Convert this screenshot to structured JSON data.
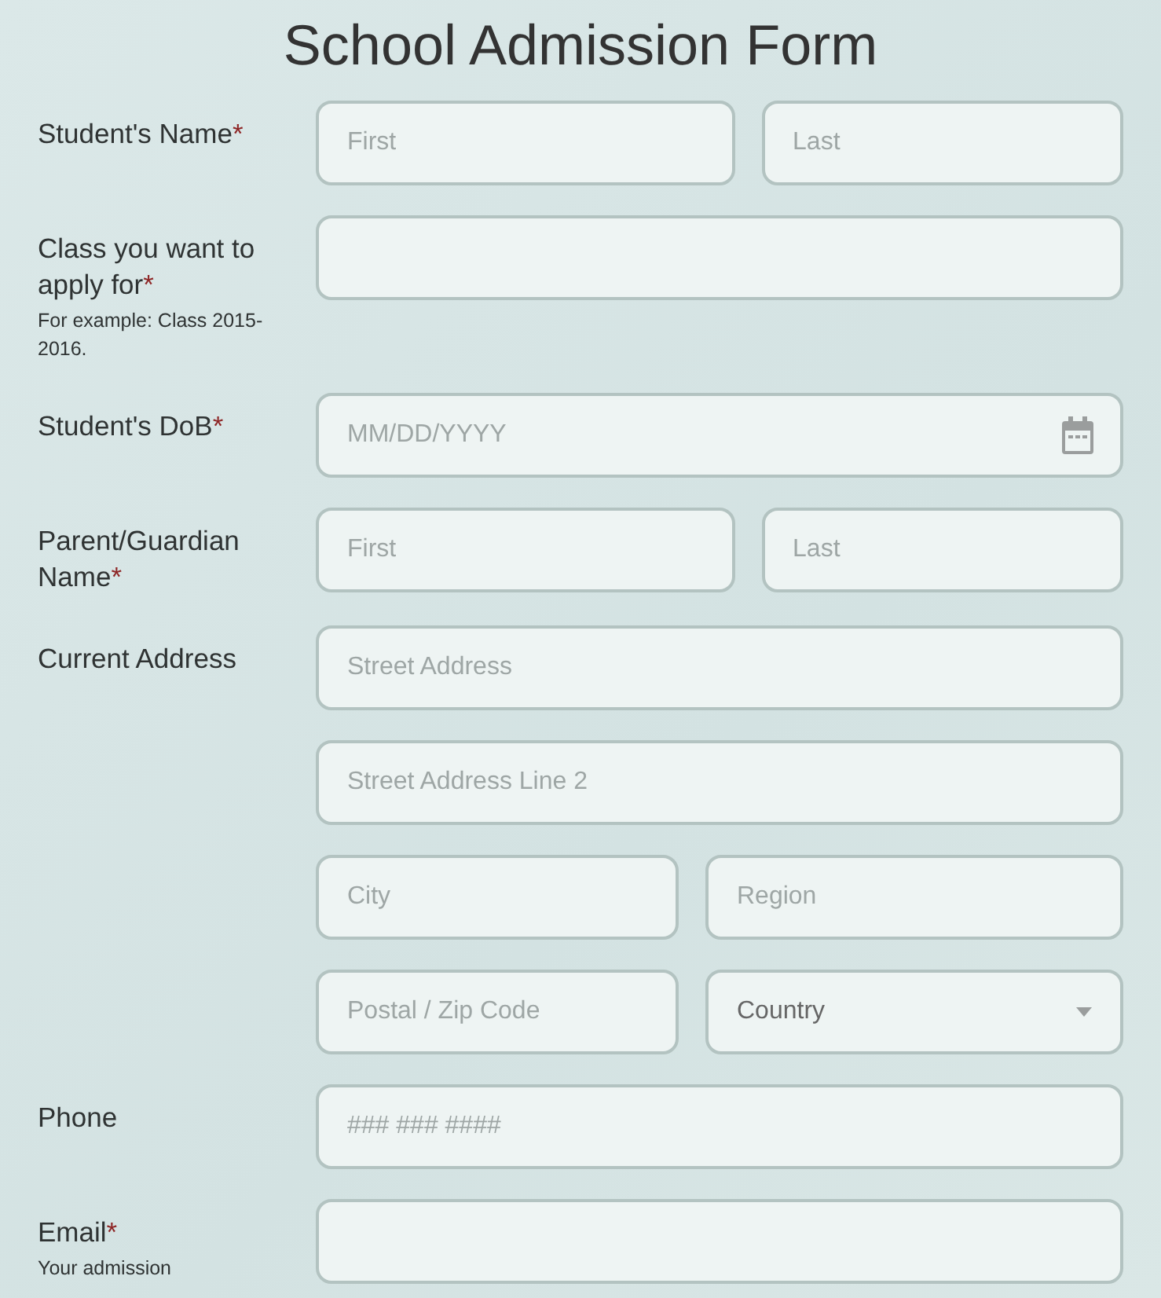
{
  "title": "School Admission Form",
  "rows": [
    {
      "label": "Student's Name",
      "required_mark": "*",
      "lines": [
        [
          {
            "kind": "text",
            "placeholder": "First"
          },
          {
            "kind": "text",
            "placeholder": "Last"
          }
        ]
      ]
    },
    {
      "label": "Class you want to apply for",
      "required_mark": "*",
      "hint": "For example: Class 2015-2016.",
      "lines": [
        [
          {
            "kind": "text"
          }
        ]
      ]
    },
    {
      "label": "Student's DoB",
      "required_mark": "*",
      "lines": [
        [
          {
            "kind": "date",
            "placeholder": "MM/DD/YYYY"
          }
        ]
      ]
    },
    {
      "label": "Parent/Guardian Name",
      "required_mark": "*",
      "lines": [
        [
          {
            "kind": "text",
            "placeholder": "First"
          },
          {
            "kind": "text",
            "placeholder": "Last"
          }
        ]
      ]
    },
    {
      "label": "Current Address",
      "lines": [
        [
          {
            "kind": "text",
            "placeholder": "Street Address"
          }
        ],
        [
          {
            "kind": "text",
            "placeholder": "Street Address Line 2"
          }
        ],
        [
          {
            "kind": "text",
            "placeholder": "City"
          },
          {
            "kind": "text",
            "placeholder": "Region"
          }
        ],
        [
          {
            "kind": "text",
            "placeholder": "Postal / Zip Code"
          },
          {
            "kind": "select",
            "value": "Country"
          }
        ]
      ]
    },
    {
      "label": "Phone",
      "lines": [
        [
          {
            "kind": "text",
            "placeholder": "### ### ####"
          }
        ]
      ]
    },
    {
      "label": "Email",
      "required_mark": "*",
      "hint": "Your admission",
      "lines": [
        [
          {
            "kind": "text"
          }
        ]
      ]
    }
  ]
}
